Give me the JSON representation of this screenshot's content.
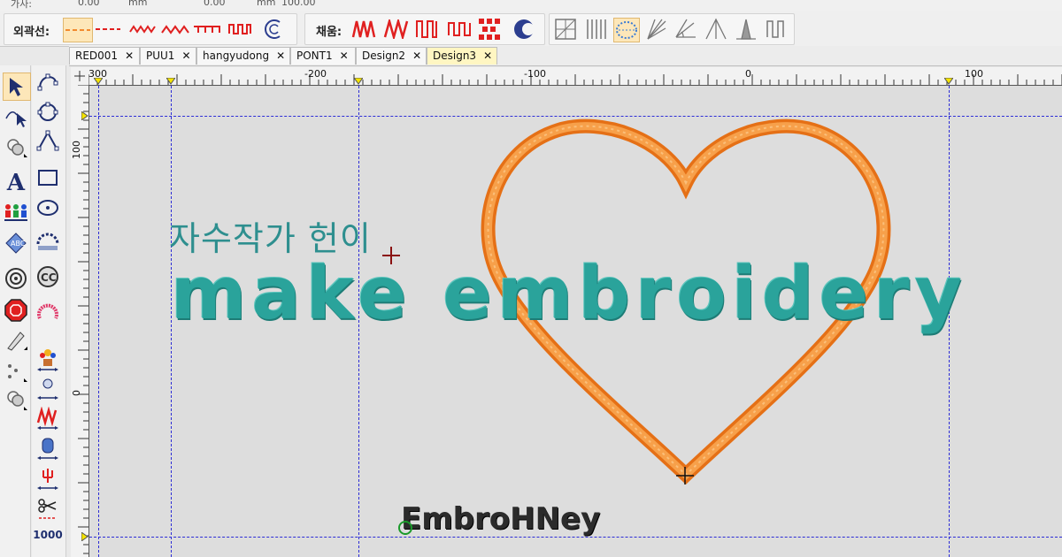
{
  "toolbar": {
    "outline_label": "외곽선:",
    "fill_label": "채움:"
  },
  "tabs": [
    {
      "label": "RED001",
      "close": "✕",
      "active": false
    },
    {
      "label": "PUU1",
      "close": "✕",
      "active": false
    },
    {
      "label": "hangyudong",
      "close": "✕",
      "active": false
    },
    {
      "label": "PONT1",
      "close": "✕",
      "active": false
    },
    {
      "label": "Design2",
      "close": "✕",
      "active": false
    },
    {
      "label": "Design3",
      "close": "✕",
      "active": true
    }
  ],
  "ruler": {
    "h_labels": [
      "300",
      "-200",
      "-100",
      "0",
      "100"
    ],
    "v_labels": [
      "100",
      "0"
    ]
  },
  "left_toolbar": {
    "stitch_count_label": "1000"
  },
  "canvas": {
    "korean_text": "자수작가 헌이",
    "main_text": "make embroidery",
    "brand_text": "EmbroHNey"
  },
  "colors": {
    "thread_teal": "#2aa39b",
    "thread_orange": "#f28a2e",
    "thread_dark": "#2b2b2b",
    "guide_blue": "#2c2cd6",
    "canvas_bg": "#dddddd"
  }
}
